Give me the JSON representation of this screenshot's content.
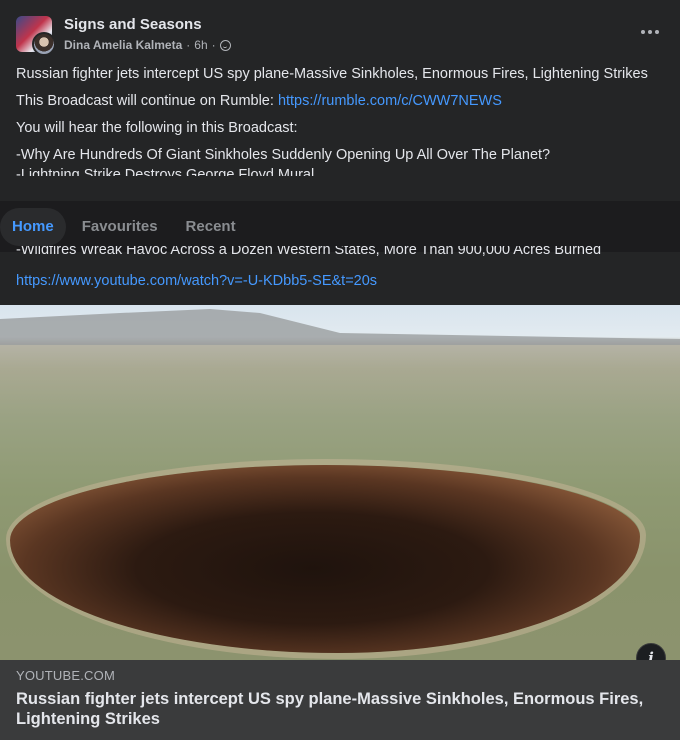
{
  "post": {
    "group_name": "Signs and Seasons",
    "author": "Dina Amelia Kalmeta",
    "time": "6h",
    "separator": "·",
    "title_text": "Russian fighter jets intercept US spy plane-Massive Sinkholes, Enormous Fires, Lightening Strikes",
    "rumble_prefix": "This Broadcast will continue on Rumble: ",
    "rumble_link": "https://rumble.com/c/CWW7NEWS",
    "hear_intro": "You will hear the following in this Broadcast:",
    "bullet_1": "-Why Are Hundreds Of Giant Sinkholes Suddenly Opening Up All Over The Planet?",
    "bullet_2": "-Lightning Strike Destroys George Floyd Mural",
    "bullet_3": "-Wildfires Wreak Havoc Across a Dozen Western States, More Than 900,000 Acres Burned",
    "youtube_link": "https://www.youtube.com/watch?v=-U-KDbb5-SE&t=20s"
  },
  "tabs": [
    {
      "label": "Home",
      "active": true
    },
    {
      "label": "Favourites",
      "active": false
    },
    {
      "label": "Recent",
      "active": false
    }
  ],
  "preview": {
    "domain": "YOUTUBE.COM",
    "title": "Russian fighter jets intercept US spy plane-Massive Sinkholes, Enormous Fires, Lightening Strikes",
    "info_label": "i"
  },
  "icons": {
    "globe": "globe-icon",
    "more": "more-options-icon",
    "info": "info-icon"
  },
  "colors": {
    "background": "#242526",
    "link": "#4599ff",
    "active_tab": "#4599ff",
    "preview_bar": "#3a3b3c"
  }
}
